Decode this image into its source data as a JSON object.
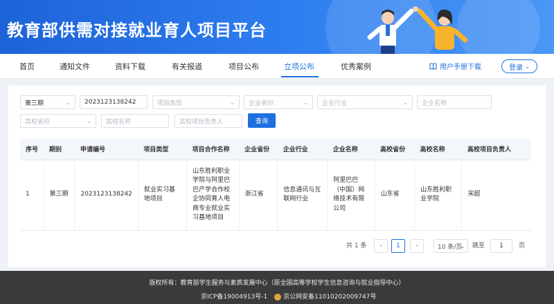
{
  "site": {
    "title": "教育部供需对接就业育人项目平台"
  },
  "nav": {
    "items": [
      {
        "label": "首页"
      },
      {
        "label": "通知文件"
      },
      {
        "label": "资料下载"
      },
      {
        "label": "有关报道"
      },
      {
        "label": "项目公布"
      },
      {
        "label": "立项公布"
      },
      {
        "label": "优秀案例"
      }
    ],
    "active_index": 5,
    "manual_label": "用户手册下载",
    "login_label": "登录"
  },
  "filters": {
    "period_value": "第三期",
    "apply_no_value": "2023123138242",
    "project_type_ph": "项目类型",
    "company_province_ph": "企业省份",
    "company_industry_ph": "企业行业",
    "company_name_ph": "企业名称",
    "school_province_ph": "高校省份",
    "school_name_ph": "高校名称",
    "school_lead_ph": "高校项目负责人",
    "query_label": "查询"
  },
  "table": {
    "headers": [
      "序号",
      "期别",
      "申请编号",
      "项目类型",
      "项目合作名称",
      "企业省份",
      "企业行业",
      "企业名称",
      "高校省份",
      "高校名称",
      "高校项目负责人"
    ],
    "rows": [
      [
        "1",
        "第三期",
        "2023123138242",
        "就业实习基地项目",
        "山东胜利职业学院与阿里巴巴产学合作校企协同育人电商专业就业实习基地项目",
        "浙江省",
        "信息通讯与互联网行业",
        "阿里巴巴（中国）网络技术有限公司",
        "山东省",
        "山东胜利职业学院",
        "宋超"
      ]
    ]
  },
  "pagination": {
    "total_label": "共 1 条",
    "current_page": "1",
    "page_size": "10 条/页",
    "goto_label": "跳至",
    "goto_value": "1",
    "page_suffix": "页"
  },
  "footer": {
    "copyright": "版权所有：教育部学生服务与素质发展中心（原全国高等学校学生信息咨询与就业指导中心）",
    "icp": "京ICP备19004913号-1",
    "police": "京公网安备11010202009747号"
  },
  "colors": {
    "accent": "#1e6fe0",
    "banner": "#2f7ff0",
    "footer": "#3b3b3e"
  }
}
